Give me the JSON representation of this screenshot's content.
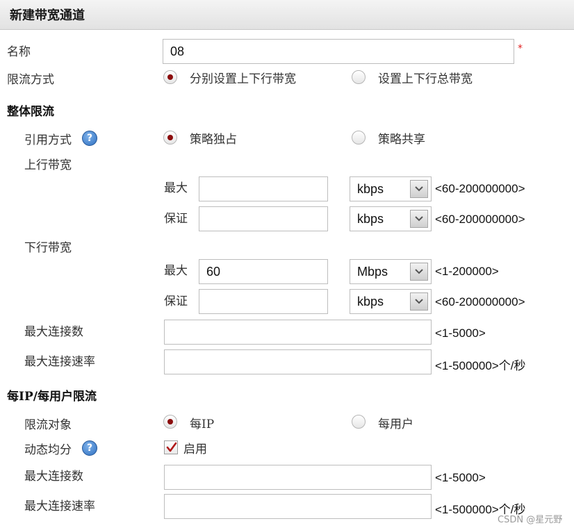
{
  "header": {
    "title": "新建带宽通道"
  },
  "form": {
    "name_label": "名称",
    "name_value": "08",
    "required_mark": "*",
    "limit_mode_label": "限流方式",
    "limit_mode_options": [
      "分别设置上下行带宽",
      "设置上下行总带宽"
    ],
    "limit_mode_selected": "分别设置上下行带宽"
  },
  "overall": {
    "section_title": "整体限流",
    "ref_mode_label": "引用方式",
    "ref_mode_options": [
      "策略独占",
      "策略共享"
    ],
    "ref_mode_selected": "策略独占",
    "up_label": "上行带宽",
    "down_label": "下行带宽",
    "max_label": "最大",
    "guarantee_label": "保证",
    "up_max": {
      "value": "",
      "unit": "kbps",
      "range": "<60-200000000>"
    },
    "up_guarantee": {
      "value": "",
      "unit": "kbps",
      "range": "<60-200000000>"
    },
    "down_max": {
      "value": "60",
      "unit": "Mbps",
      "range": "<1-200000>"
    },
    "down_guarantee": {
      "value": "",
      "unit": "kbps",
      "range": "<60-200000000>"
    },
    "max_conn_label": "最大连接数",
    "max_conn_value": "",
    "max_conn_range": "<1-5000>",
    "max_conn_rate_label": "最大连接速率",
    "max_conn_rate_value": "",
    "max_conn_rate_range": "<1-500000>个/秒"
  },
  "per_ip": {
    "section_title": "每IP/每用户限流",
    "target_label": "限流对象",
    "target_options": [
      "每IP",
      "每用户"
    ],
    "target_selected": "每IP",
    "dynamic_label": "动态均分",
    "dynamic_checkbox_label": "启用",
    "dynamic_enabled": true,
    "max_conn_label": "最大连接数",
    "max_conn_value": "",
    "max_conn_range": "<1-5000>",
    "max_conn_rate_label": "最大连接速率",
    "max_conn_rate_value": "",
    "max_conn_rate_range": "<1-500000>个/秒"
  },
  "watermark": "CSDN @星元野",
  "icons": {
    "help": "help-icon",
    "dropdown": "chevron-down-icon",
    "check": "checkmark-icon"
  },
  "colors": {
    "radio_dot": "#8b0d0d",
    "required": "#e02020",
    "help_icon": "#2e6fc0",
    "check": "#b01818"
  }
}
